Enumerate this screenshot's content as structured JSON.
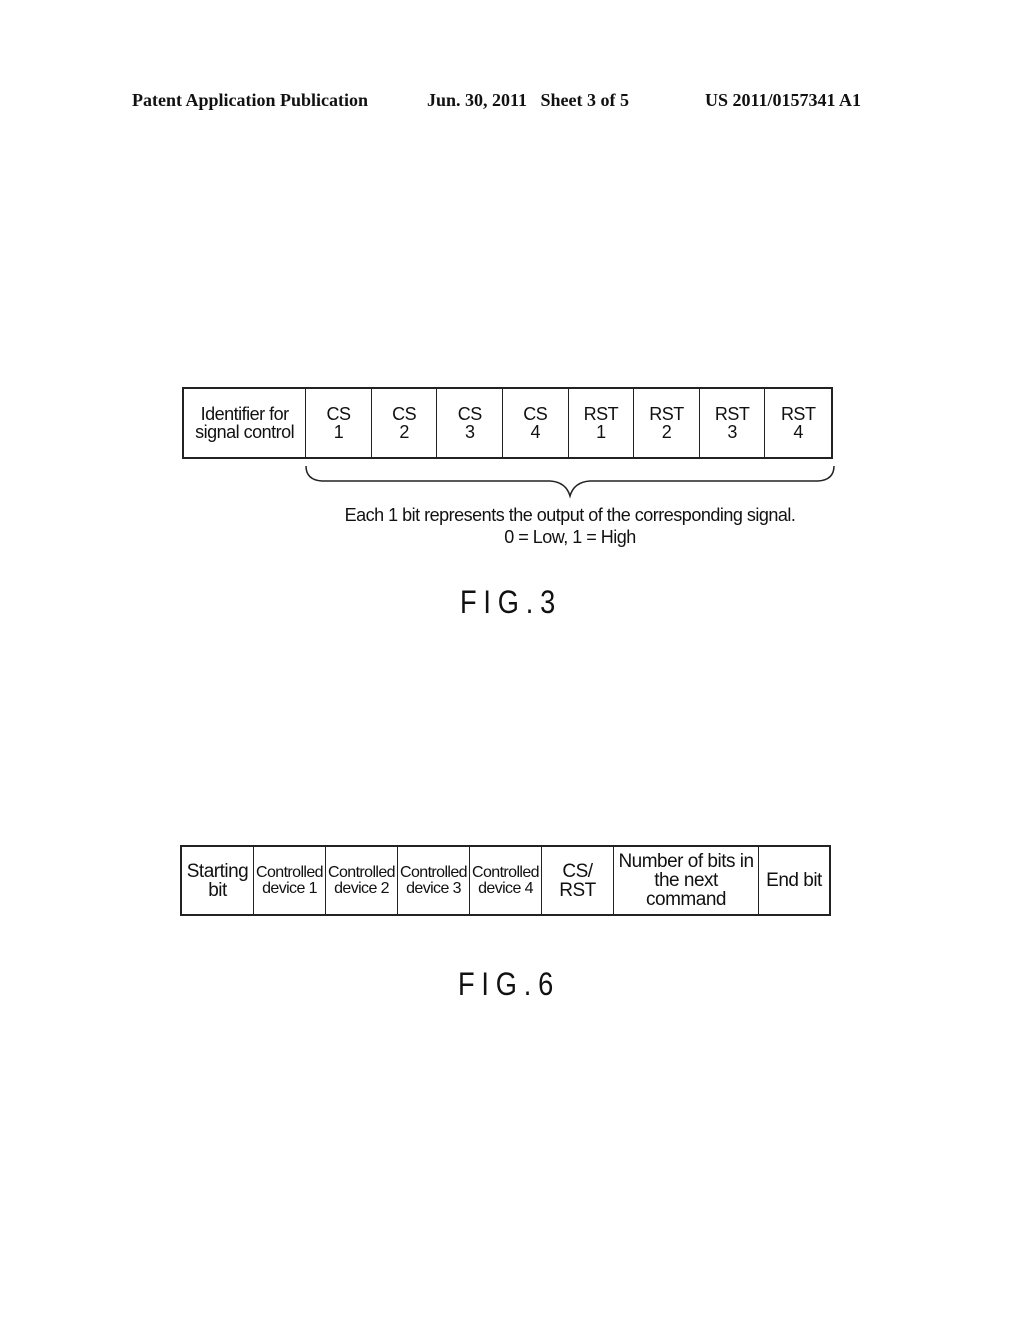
{
  "header": {
    "publication": "Patent Application Publication",
    "date_sheet": "Jun. 30, 2011   Sheet 3 of 5",
    "patent_number": "US 2011/0157341 A1"
  },
  "fig3": {
    "fields": [
      {
        "line1": "Identifier for",
        "line2": "signal control"
      },
      {
        "line1": "CS",
        "line2": "1"
      },
      {
        "line1": "CS",
        "line2": "2"
      },
      {
        "line1": "CS",
        "line2": "3"
      },
      {
        "line1": "CS",
        "line2": "4"
      },
      {
        "line1": "RST",
        "line2": "1"
      },
      {
        "line1": "RST",
        "line2": "2"
      },
      {
        "line1": "RST",
        "line2": "3"
      },
      {
        "line1": "RST",
        "line2": "4"
      }
    ],
    "note_line1": "Each 1 bit represents the output of the corresponding signal.",
    "note_line2": "0 = Low, 1 = High",
    "label": "FIG.3"
  },
  "fig6": {
    "fields": [
      {
        "line1": "Starting",
        "line2": "bit"
      },
      {
        "line1": "Controlled",
        "line2": "device 1"
      },
      {
        "line1": "Controlled",
        "line2": "device 2"
      },
      {
        "line1": "Controlled",
        "line2": "device 3"
      },
      {
        "line1": "Controlled",
        "line2": "device 4"
      },
      {
        "line1": "CS/",
        "line2": "RST"
      },
      {
        "line1": "Number of bits in",
        "line2": "the next command"
      },
      {
        "line1": "End bit",
        "line2": ""
      }
    ],
    "label": "FIG.6"
  }
}
